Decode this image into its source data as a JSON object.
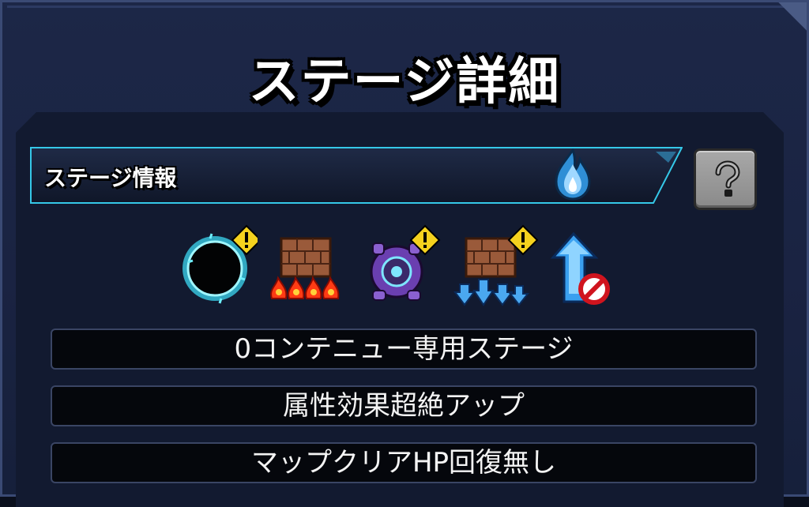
{
  "header": {
    "title": "ステージ詳細"
  },
  "stage_info": {
    "label": "ステージ情報",
    "element_icon": "blue-flame-icon",
    "help_icon": "question-icon"
  },
  "gimmicks": [
    {
      "icon": "black-hole-icon",
      "warning": true
    },
    {
      "icon": "damage-wall-fire-icon",
      "warning": false
    },
    {
      "icon": "purple-device-icon",
      "warning": true
    },
    {
      "icon": "damage-wall-ice-icon",
      "warning": true
    },
    {
      "icon": "speed-up-cancel-icon",
      "warning": false
    }
  ],
  "rules": [
    {
      "text": "0コンテニュー専用ステージ"
    },
    {
      "text": "属性効果超絶アップ"
    },
    {
      "text": "マップクリアHP回復無し"
    }
  ],
  "colors": {
    "background": "#1a2342",
    "panel": "#121a30",
    "accent_cyan": "#35c8e8",
    "warning_yellow": "#f5d21e",
    "rule_box": "#05070c"
  }
}
